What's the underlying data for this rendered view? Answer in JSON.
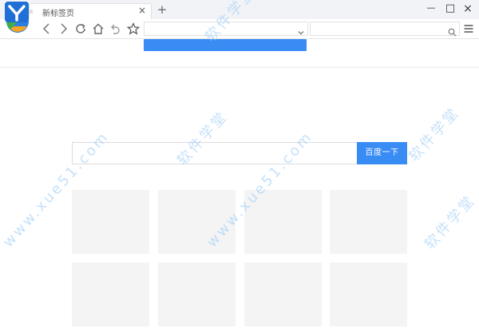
{
  "tab": {
    "title": "新标签页",
    "close_glyph": "×"
  },
  "new_tab_glyph": "+",
  "window_controls": {
    "minimize": "—",
    "maximize": "□",
    "close": "×"
  },
  "address_bar": {
    "value": ""
  },
  "search_bar": {
    "value": ""
  },
  "search": {
    "placeholder": "",
    "button_label": "百度一下"
  },
  "watermark": {
    "cn": "软件学堂",
    "url": "www.xue51.com"
  },
  "colors": {
    "accent": "#3a8cf5",
    "tile": "#f4f4f4",
    "titlebar": "#f1f3f6"
  },
  "icons": [
    "app-logo-icon",
    "back-icon",
    "forward-icon",
    "refresh-icon",
    "home-icon",
    "undo-icon",
    "star-icon",
    "chevron-down-icon",
    "search-icon",
    "menu-icon"
  ]
}
